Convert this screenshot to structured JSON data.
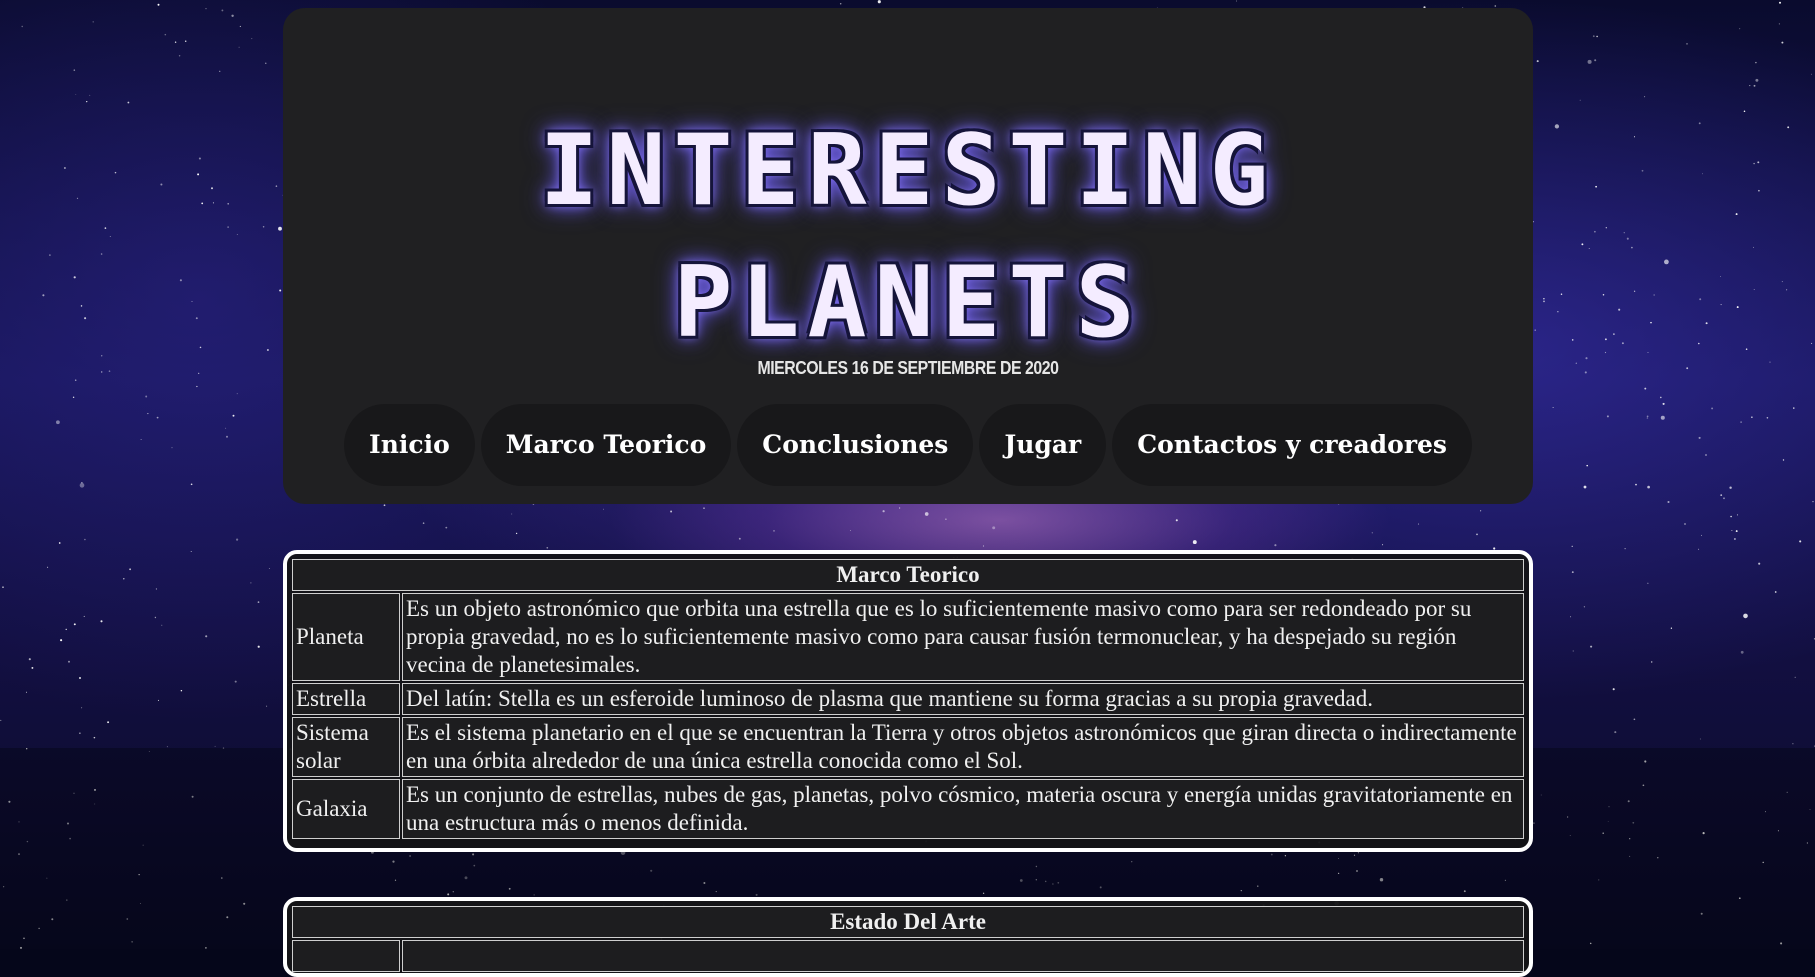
{
  "header": {
    "logo_line1": "INTERESTING",
    "logo_line2": "PLANETS",
    "date": "MIERCOLES 16 DE SEPTIEMBRE DE 2020"
  },
  "nav": {
    "items": [
      {
        "label": "Inicio"
      },
      {
        "label": "Marco Teorico"
      },
      {
        "label": "Conclusiones"
      },
      {
        "label": "Jugar"
      },
      {
        "label": "Contactos y creadores"
      }
    ]
  },
  "marco_teorico": {
    "title": "Marco Teorico",
    "rows": [
      {
        "term": "Planeta",
        "definition": "Es un objeto astronómico que orbita una estrella que es lo suficientemente masivo como para ser redondeado por su propia gravedad, no es lo suficientemente masivo como para causar fusión termonuclear, y ha despejado su región vecina de planetesimales."
      },
      {
        "term": "Estrella",
        "definition": "Del latín: Stella es un esferoide luminoso de plasma que mantiene su forma gracias a su propia gravedad."
      },
      {
        "term": "Sistema solar",
        "definition": "Es el sistema planetario en el que se encuentran la Tierra y otros objetos astronómicos que giran directa o indirectamente en una órbita alrededor de una única estrella conocida como el Sol."
      },
      {
        "term": "Galaxia",
        "definition": "Es un conjunto de estrellas, nubes de gas, planetas, polvo cósmico, materia oscura y energía unidas gravitatoriamente en una estructura más o menos definida."
      }
    ]
  },
  "estado_del_arte": {
    "title": "Estado Del Arte"
  },
  "theme": {
    "panel_bg": "#202022",
    "nav_bg": "#18181a",
    "logo_glow": "#8f7cff",
    "table_border": "#ffffff"
  }
}
